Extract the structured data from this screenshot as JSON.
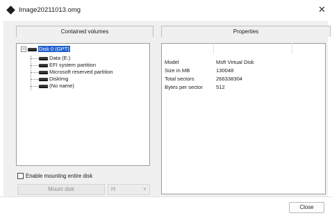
{
  "window": {
    "title": "Image20211013.omg",
    "icon": "diamond-icon",
    "close_glyph": "✕"
  },
  "volumes_panel": {
    "header": "Contained volumes",
    "tree": {
      "root": {
        "label": "Disk 0 (GPT)",
        "expanded": true,
        "selected": true,
        "expander_glyph": "−"
      },
      "children": [
        {
          "label": "Data (E:)"
        },
        {
          "label": "EFI system partition"
        },
        {
          "label": "Microsoft reserved partition"
        },
        {
          "label": "DiskImg"
        },
        {
          "label": "(No name)"
        }
      ]
    }
  },
  "properties_panel": {
    "header": "Properties",
    "rows": [
      {
        "key": "Model",
        "value": "Msft Virtual Disk"
      },
      {
        "key": "Size in MB",
        "value": "130048"
      },
      {
        "key": "Total sectors",
        "value": "266338304"
      },
      {
        "key": "Bytes per sector",
        "value": "512"
      }
    ]
  },
  "mount": {
    "checkbox_label": "Enable mounting entire disk",
    "checked": false,
    "button_label": "Mount disk",
    "drive_value": "H:",
    "enabled": false
  },
  "footer": {
    "close_label": "Close"
  },
  "colors": {
    "selection": "#1f5fd0",
    "client_bg": "#f0f0f0"
  }
}
